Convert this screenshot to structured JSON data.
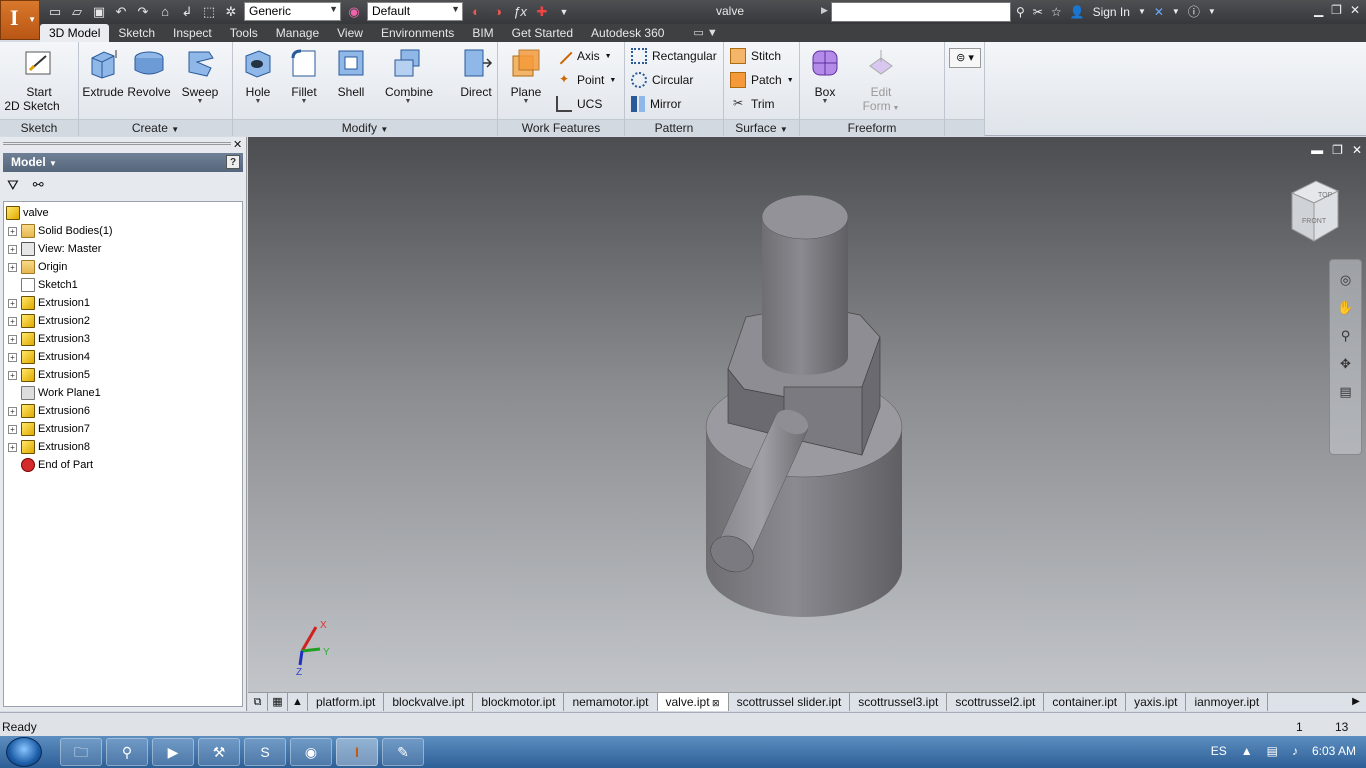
{
  "titlebar": {
    "document_title": "valve",
    "material_combo": "Generic",
    "appearance_combo": "Default",
    "signin": "Sign In",
    "icons": [
      "new-icon",
      "open-icon",
      "save-icon",
      "undo-icon",
      "redo-icon",
      "home-icon",
      "return-icon",
      "select-icon",
      "material-icon",
      "appearance-icon",
      "fx-icon",
      "measure-icon"
    ]
  },
  "ribbon": {
    "tabs": [
      "3D Model",
      "Sketch",
      "Inspect",
      "Tools",
      "Manage",
      "View",
      "Environments",
      "BIM",
      "Get Started",
      "Autodesk 360"
    ],
    "active_tab": "3D Model",
    "groups": {
      "sketch": {
        "title": "Sketch",
        "start_label": "Start",
        "start_label2": "2D Sketch"
      },
      "create": {
        "title": "Create",
        "extrude": "Extrude",
        "revolve": "Revolve",
        "sweep": "Sweep"
      },
      "modify": {
        "title": "Modify",
        "hole": "Hole",
        "fillet": "Fillet",
        "shell": "Shell",
        "combine": "Combine",
        "direct": "Direct"
      },
      "work_features": {
        "title": "Work Features",
        "plane": "Plane",
        "axis": "Axis",
        "point": "Point",
        "ucs": "UCS"
      },
      "pattern": {
        "title": "Pattern",
        "rectangular": "Rectangular",
        "circular": "Circular",
        "mirror": "Mirror"
      },
      "surface": {
        "title": "Surface",
        "stitch": "Stitch",
        "patch": "Patch",
        "trim": "Trim"
      },
      "freeform": {
        "title": "Freeform",
        "box": "Box",
        "edit1": "Edit",
        "edit2": "Form"
      }
    }
  },
  "browser": {
    "title": "Model",
    "tree": [
      {
        "label": "valve",
        "icon": "part",
        "expander": false,
        "indent": 0
      },
      {
        "label": "Solid Bodies(1)",
        "icon": "folder",
        "expander": true,
        "indent": 1
      },
      {
        "label": "View: Master",
        "icon": "view",
        "expander": true,
        "indent": 1
      },
      {
        "label": "Origin",
        "icon": "folder",
        "expander": true,
        "indent": 1
      },
      {
        "label": "Sketch1",
        "icon": "sketch",
        "expander": false,
        "indent": 1
      },
      {
        "label": "Extrusion1",
        "icon": "extrusion",
        "expander": true,
        "indent": 1
      },
      {
        "label": "Extrusion2",
        "icon": "extrusion",
        "expander": true,
        "indent": 1
      },
      {
        "label": "Extrusion3",
        "icon": "extrusion",
        "expander": true,
        "indent": 1
      },
      {
        "label": "Extrusion4",
        "icon": "extrusion",
        "expander": true,
        "indent": 1
      },
      {
        "label": "Extrusion5",
        "icon": "extrusion",
        "expander": true,
        "indent": 1
      },
      {
        "label": "Work Plane1",
        "icon": "workplane",
        "expander": false,
        "indent": 1
      },
      {
        "label": "Extrusion6",
        "icon": "extrusion",
        "expander": true,
        "indent": 1
      },
      {
        "label": "Extrusion7",
        "icon": "extrusion",
        "expander": true,
        "indent": 1
      },
      {
        "label": "Extrusion8",
        "icon": "extrusion",
        "expander": true,
        "indent": 1
      },
      {
        "label": "End of Part",
        "icon": "end",
        "expander": false,
        "indent": 1
      }
    ]
  },
  "viewport": {
    "viewcube_labels": [
      "FRONT",
      "TOP"
    ],
    "axis_labels": [
      "X",
      "Y",
      "Z"
    ]
  },
  "document_tabs": [
    "platform.ipt",
    "blockvalve.ipt",
    "blockmotor.ipt",
    "nemamotor.ipt",
    "valve.ipt",
    "scottrussel slider.ipt",
    "scottrussel3.ipt",
    "scottrussel2.ipt",
    "container.ipt",
    "yaxis.ipt",
    "ianmoyer.ipt"
  ],
  "active_document": "valve.ipt",
  "status": {
    "text": "Ready",
    "num1": "1",
    "num2": "13"
  },
  "taskbar": {
    "apps": [
      "explorer-icon",
      "search-icon",
      "media-icon",
      "tools-icon",
      "skype-icon",
      "firefox-icon",
      "inventor-icon",
      "paint-icon"
    ],
    "lang": "ES",
    "clock": "6:03 AM"
  }
}
